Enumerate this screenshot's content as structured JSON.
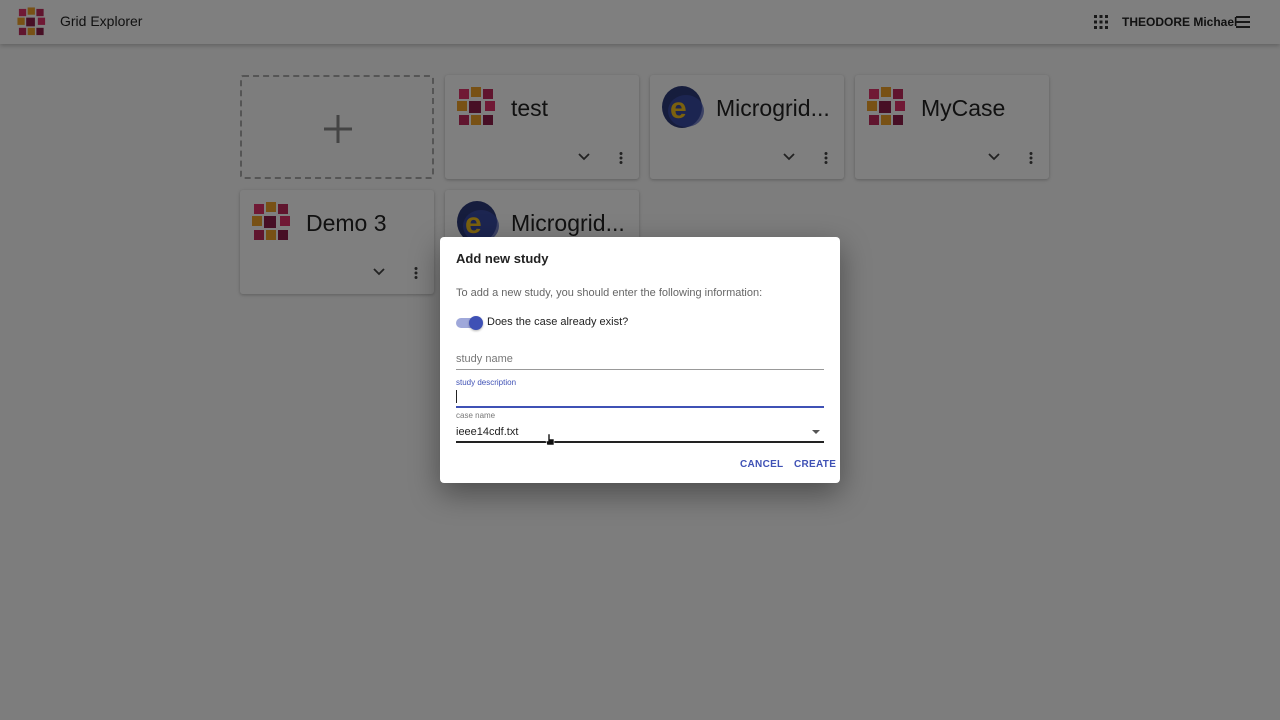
{
  "app": {
    "title": "Grid Explorer",
    "user": "THEODORE Michael",
    "icons": {
      "logo": "cube-grid-logo",
      "apps": "apps-grid-icon",
      "menu": "hamburger-menu-icon"
    }
  },
  "studies": [
    {
      "title": "test",
      "icon": "cube-grid-icon"
    },
    {
      "title": "Microgrid...",
      "icon": "e-logo-icon"
    },
    {
      "title": "MyCase",
      "icon": "cube-grid-icon"
    },
    {
      "title": "Demo 3",
      "icon": "cube-grid-icon"
    },
    {
      "title": "Microgrid...",
      "icon": "e-logo-icon"
    }
  ],
  "dialog": {
    "title": "Add new study",
    "intro": "To add a new study, you should enter the following information:",
    "toggle_label": "Does the case already exist?",
    "toggle_on": true,
    "study_name_placeholder": "study name",
    "study_description_label": "study description",
    "study_description_value": "",
    "case_name_label": "case name",
    "case_name_value": "ieee14cdf.txt",
    "cancel_label": "CANCEL",
    "create_label": "CREATE"
  },
  "colors": {
    "primary": "#3f51b5",
    "primary_light": "#9fa8da",
    "backdrop": "rgba(0,0,0,0.5)"
  }
}
